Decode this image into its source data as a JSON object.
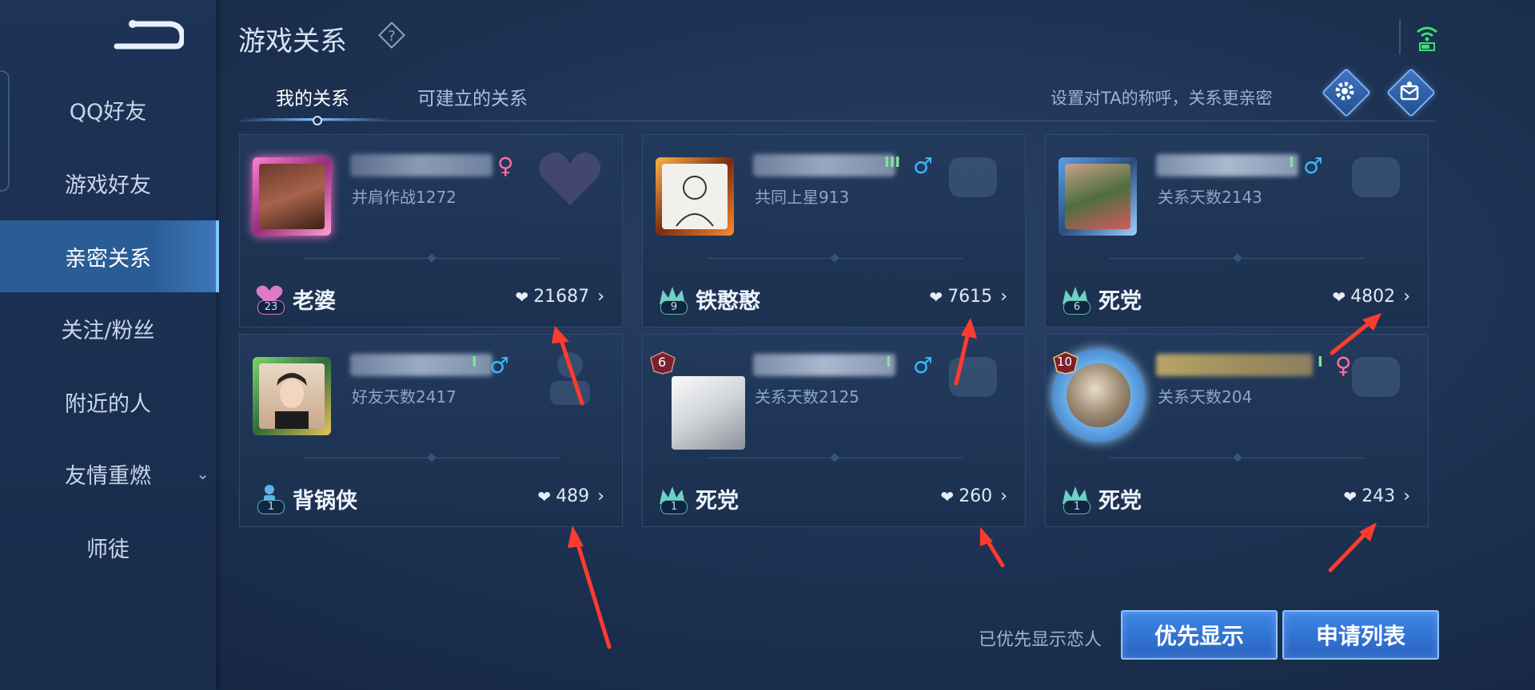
{
  "header": {
    "title": "游戏关系"
  },
  "sidebar": {
    "items": [
      {
        "label": "QQ好友"
      },
      {
        "label": "游戏好友"
      },
      {
        "label": "亲密关系",
        "active": true
      },
      {
        "label": "关注/粉丝"
      },
      {
        "label": "附近的人"
      },
      {
        "label": "友情重燃",
        "has_dropdown": true
      },
      {
        "label": "师徒"
      }
    ]
  },
  "tabs": [
    {
      "label": "我的关系",
      "active": true
    },
    {
      "label": "可建立的关系"
    }
  ],
  "hint": "设置对TA的称呼，关系更亲密",
  "cards": [
    {
      "gender": "♀",
      "subtitle": "并肩作战1272",
      "relation_level": "23",
      "relation": "老婆",
      "intimacy": "21687"
    },
    {
      "rank": "III",
      "gender": "♂",
      "subtitle": "共同上星913",
      "relation_level": "9",
      "relation": "铁憨憨",
      "intimacy": "7615"
    },
    {
      "rank": "I",
      "gender": "♂",
      "subtitle": "关系天数2143",
      "relation_level": "6",
      "relation": "死党",
      "intimacy": "4802"
    },
    {
      "rank": "I",
      "gender": "♂",
      "subtitle": "好友天数2417",
      "relation_level": "1",
      "relation": "背锅侠",
      "intimacy": "489"
    },
    {
      "avatar_level": "6",
      "rank": "I",
      "gender": "♂",
      "subtitle": "关系天数2125",
      "relation_level": "1",
      "relation": "死党",
      "intimacy": "260"
    },
    {
      "avatar_level": "10",
      "rank": "I",
      "gender": "♀",
      "subtitle": "关系天数204",
      "relation_level": "1",
      "relation": "死党",
      "intimacy": "243"
    }
  ],
  "footer": {
    "status": "已优先显示恋人",
    "priority_button": "优先显示",
    "request_list_button": "申请列表"
  },
  "icons": {
    "back": "back-arrow-icon",
    "help": "question-diamond-icon",
    "signal": "wifi-signal-icon",
    "settings": "gear-icon",
    "mailbox": "mailbox-icon",
    "heart": "heart-icon",
    "chevron": "chevron-right-icon"
  },
  "colors": {
    "accent": "#3d86e6",
    "female": "#ff6fa3",
    "male": "#38b6ff",
    "annotation_arrow": "#ff3b2f"
  }
}
